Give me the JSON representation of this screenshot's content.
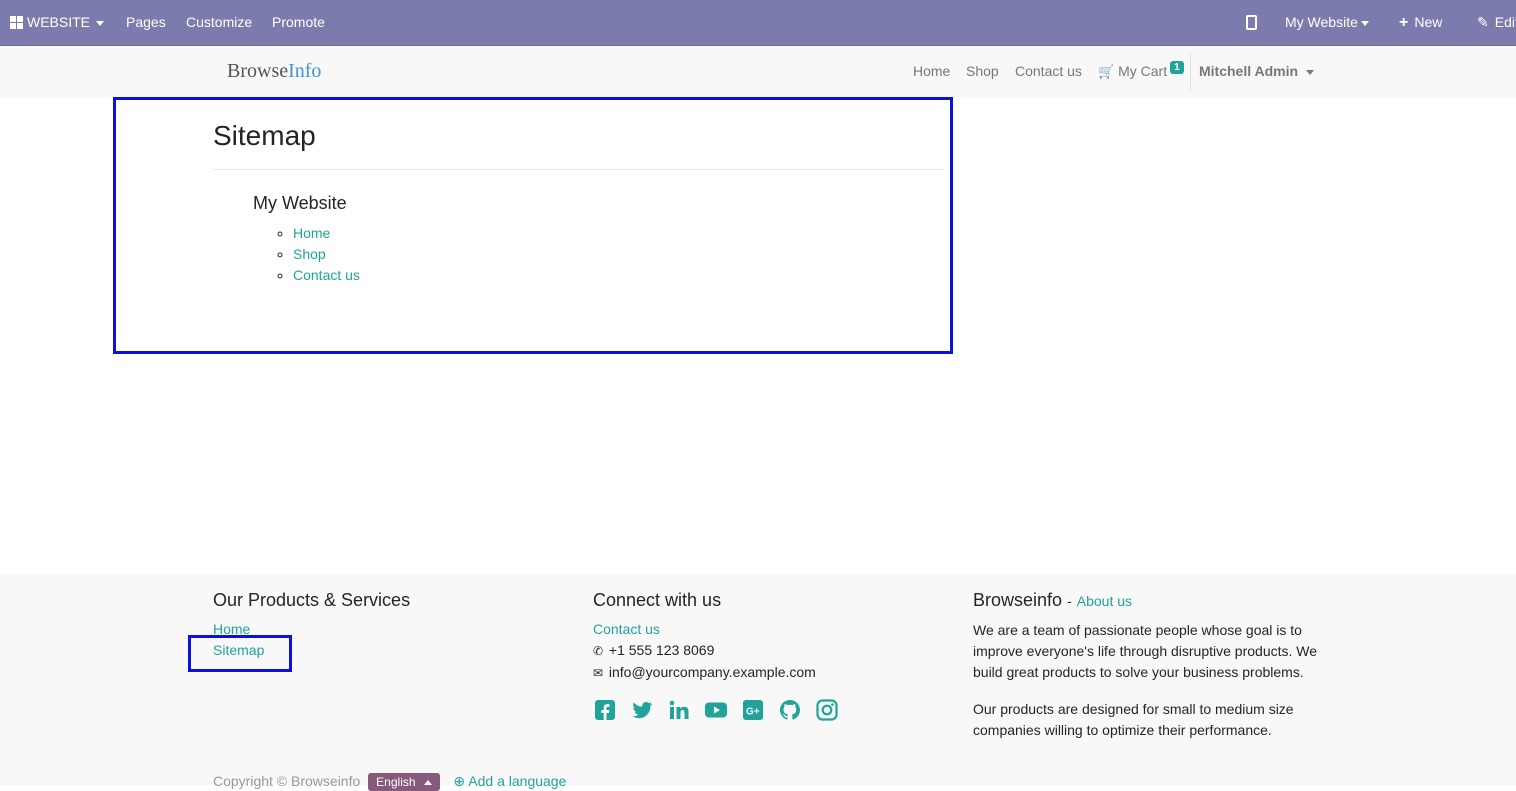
{
  "admin_bar": {
    "app_label": "WEBSITE",
    "pages": "Pages",
    "customize": "Customize",
    "promote": "Promote",
    "website_switch": "My Website",
    "new": "New",
    "edit": "Edit"
  },
  "header": {
    "logo_part1": "Browse",
    "logo_part2": "Info",
    "nav": [
      "Home",
      "Shop",
      "Contact us"
    ],
    "cart_label": "My Cart",
    "cart_count": "1",
    "user": "Mitchell Admin"
  },
  "main": {
    "title": "Sitemap",
    "site_name": "My Website",
    "pages": [
      "Home",
      "Shop",
      "Contact us"
    ]
  },
  "footer": {
    "col1": {
      "title": "Our Products & Services",
      "links": [
        "Home",
        "Sitemap"
      ]
    },
    "col2": {
      "title": "Connect with us",
      "contact": "Contact us",
      "phone": "+1 555 123 8069",
      "email": "info@yourcompany.example.com",
      "social_icons": [
        "facebook-icon",
        "twitter-icon",
        "linkedin-icon",
        "youtube-icon",
        "google-plus-icon",
        "github-icon",
        "instagram-icon"
      ]
    },
    "col3": {
      "title": "Browseinfo",
      "sep": "-",
      "about": "About us",
      "p1": "We are a team of passionate people whose goal is to improve everyone's life through disruptive products. We build great products to solve your business problems.",
      "p2": "Our products are designed for small to medium size companies willing to optimize their performance."
    },
    "copyright": "Copyright © Browseinfo",
    "language": "English",
    "add_language": "Add a language"
  },
  "colors": {
    "admin_bar": "#7c7bad",
    "link": "#21a29a",
    "annotation": "#0a12d9",
    "language_button": "#875a7b"
  }
}
